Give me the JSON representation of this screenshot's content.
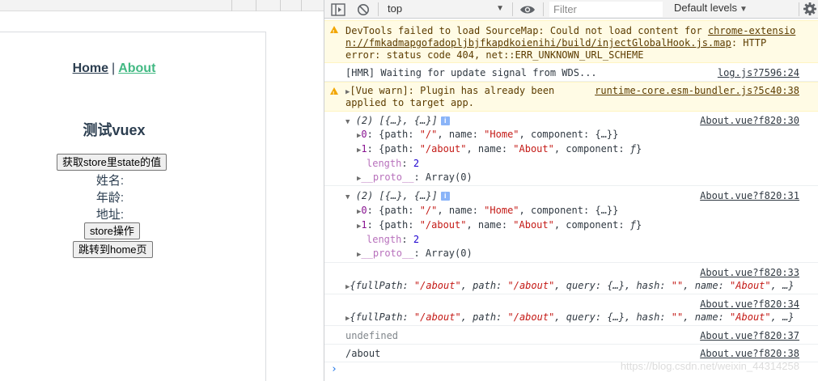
{
  "app": {
    "nav": {
      "home": "Home",
      "separator": "|",
      "about": "About"
    },
    "title": "测试vuex",
    "buttons": {
      "get_state": "获取store里state的值",
      "store_op": "store操作",
      "goto_home": "跳转到home页"
    },
    "fields": {
      "name": "姓名:",
      "age": "年龄:",
      "address": "地址:"
    },
    "colors": {
      "text": "#2c3e50",
      "active_link": "#42b983"
    }
  },
  "devtools": {
    "toolbar": {
      "context": "top",
      "filter_placeholder": "Filter",
      "levels": "Default levels"
    },
    "messages": {
      "m1": {
        "line1a": "DevTools failed to load SourceMap: Could not load content for ",
        "line1b": "chrome-extensio",
        "line2a": "n://fmkadmapgofadopljbjfkapdkoienihi/build/injectGlobalHook.js.map",
        "line2b": ": HTTP",
        "line3": "error: status code 404, net::ERR_UNKNOWN_URL_SCHEME"
      },
      "m2": {
        "text": "[HMR] Waiting for update signal from WDS...",
        "src": "log.js?7596:24"
      },
      "m3": {
        "line1": "[Vue warn]: Plugin has already been",
        "line2": "applied to target app.",
        "src": "runtime-core.esm-bundler.js?5c40:38"
      },
      "m4": {
        "header": "(2) [{…}, {…}]",
        "src": "About.vue?f820:30",
        "item0": {
          "index": "0",
          "pre": ": {path: ",
          "path": "\"/\"",
          "mid": ", name: ",
          "name": "\"Home\"",
          "post": ", component: {…}}"
        },
        "item1": {
          "index": "1",
          "pre": ": {path: ",
          "path": "\"/about\"",
          "mid": ", name: ",
          "name": "\"About\"",
          "post": ", component: ",
          "fn": "ƒ",
          "end": "}"
        },
        "length_key": "length",
        "length_val": "2",
        "proto_key": "__proto__",
        "proto_val": ": Array(0)"
      },
      "m5": {
        "header": "(2) [{…}, {…}]",
        "src": "About.vue?f820:31",
        "item0": {
          "index": "0",
          "pre": ": {path: ",
          "path": "\"/\"",
          "mid": ", name: ",
          "name": "\"Home\"",
          "post": ", component: {…}}"
        },
        "item1": {
          "index": "1",
          "pre": ": {path: ",
          "path": "\"/about\"",
          "mid": ", name: ",
          "name": "\"About\"",
          "post": ", component: ",
          "fn": "ƒ",
          "end": "}"
        },
        "length_key": "length",
        "length_val": "2",
        "proto_key": "__proto__",
        "proto_val": ": Array(0)"
      },
      "m6": {
        "src": "About.vue?f820:33",
        "a": "{fullPath: ",
        "fullpath": "\"/about\"",
        "b": ", path: ",
        "path": "\"/about\"",
        "c": ", query: {…}, hash: ",
        "hash": "\"\"",
        "d": ", name: ",
        "name": "\"About\"",
        "e": ", …}"
      },
      "m7": {
        "src": "About.vue?f820:34",
        "a": "{fullPath: ",
        "fullpath": "\"/about\"",
        "b": ", path: ",
        "path": "\"/about\"",
        "c": ", query: {…}, hash: ",
        "hash": "\"\"",
        "d": ", name: ",
        "name": "\"About\"",
        "e": ", …}"
      },
      "m8": {
        "text": "undefined",
        "src": "About.vue?f820:37"
      },
      "m9": {
        "text": "/about",
        "src": "About.vue?f820:38"
      }
    },
    "prompt": "›",
    "watermark": "https://blog.csdn.net/weixin_44314258"
  }
}
